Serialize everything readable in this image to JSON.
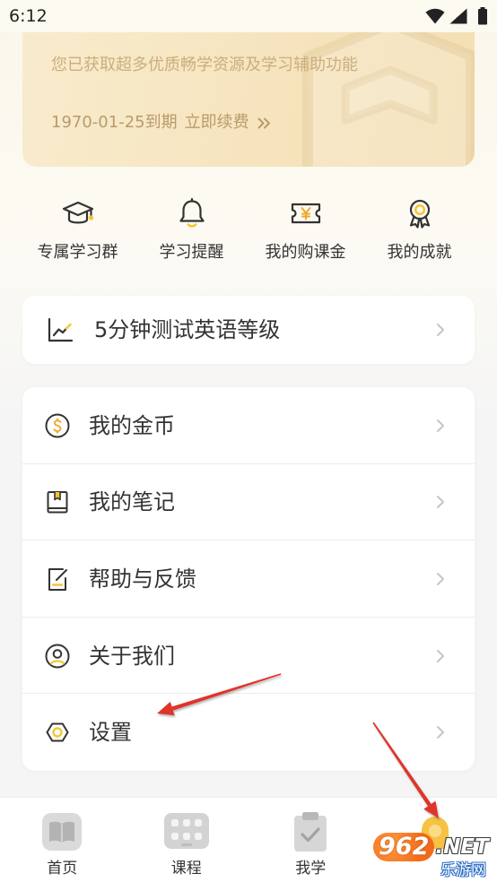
{
  "status_bar": {
    "time": "6:12",
    "icons": [
      "wifi-icon",
      "signal-icon",
      "battery-icon"
    ]
  },
  "member_card": {
    "description": "您已获取超多优质畅学资源及学习辅助功能",
    "expiry": "1970-01-25到期",
    "renew_label": "立即续费",
    "renew_icon": "double-chevron-right-icon"
  },
  "quick_actions": [
    {
      "label": "专属学习群",
      "icon": "graduation-cap-icon"
    },
    {
      "label": "学习提醒",
      "icon": "bell-icon"
    },
    {
      "label": "我的购课金",
      "icon": "ticket-yuan-icon"
    },
    {
      "label": "我的成就",
      "icon": "medal-icon"
    }
  ],
  "level_test": {
    "label": "5分钟测试英语等级",
    "icon": "line-chart-icon"
  },
  "menu": [
    {
      "label": "我的金币",
      "icon": "coin-icon"
    },
    {
      "label": "我的笔记",
      "icon": "notebook-icon"
    },
    {
      "label": "帮助与反馈",
      "icon": "feedback-icon"
    },
    {
      "label": "关于我们",
      "icon": "user-circle-icon"
    },
    {
      "label": "设置",
      "icon": "settings-icon"
    }
  ],
  "bottom_nav": {
    "tabs": [
      {
        "label": "首页",
        "icon": "book-icon",
        "active": false
      },
      {
        "label": "课程",
        "icon": "course-grid-icon",
        "active": false
      },
      {
        "label": "我学",
        "icon": "clipboard-check-icon",
        "active": false
      },
      {
        "icon": "profile-icon",
        "active": true
      }
    ]
  },
  "watermark": {
    "logo_number": "962",
    "logo_suffix": ".NET",
    "site_name": "乐游网"
  },
  "colors": {
    "accent": "#f5c531",
    "gold_card_start": "#f8ebcd",
    "gold_card_end": "#f3dfb4",
    "gold_text": "#b99b6c",
    "text_primary": "#333333",
    "chevron": "#c6c6c6",
    "nav_icon": "#d6d6d6",
    "nav_active": "#f6c244",
    "annotation_arrow": "#e0342b"
  }
}
